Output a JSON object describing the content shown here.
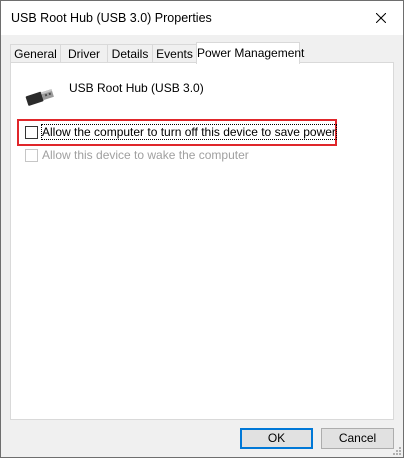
{
  "window": {
    "title": "USB Root Hub (USB 3.0) Properties"
  },
  "tabs": [
    {
      "label": "General",
      "active": false
    },
    {
      "label": "Driver",
      "active": false
    },
    {
      "label": "Details",
      "active": false
    },
    {
      "label": "Events",
      "active": false
    },
    {
      "label": "Power Management",
      "active": true
    }
  ],
  "device": {
    "name": "USB Root Hub (USB 3.0)",
    "icon": "usb-connector-icon"
  },
  "options": [
    {
      "label": "Allow the computer to turn off this device to save power",
      "checked": false,
      "enabled": true,
      "highlighted": true
    },
    {
      "label": "Allow this device to wake the computer",
      "checked": false,
      "enabled": false,
      "highlighted": false
    }
  ],
  "buttons": {
    "ok": "OK",
    "cancel": "Cancel"
  },
  "colors": {
    "highlight": "#e0262a",
    "default_button_border": "#0078d7",
    "disabled_text": "#a0a0a0"
  }
}
